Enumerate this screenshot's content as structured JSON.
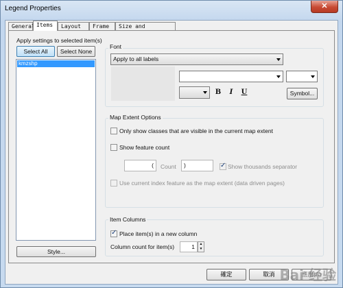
{
  "window": {
    "title": "Legend Properties",
    "close": "✕"
  },
  "tabs": [
    "General",
    "Items",
    "Layout",
    "Frame",
    "Size and Position"
  ],
  "left": {
    "apply_label": "Apply settings to selected item(s)",
    "select_all": "Select All",
    "select_none": "Select None",
    "items": [
      "kmzshp"
    ],
    "style_button": "Style..."
  },
  "font": {
    "group_label": "Font",
    "apply_combo": "Apply to all labels",
    "bold": "B",
    "italic": "I",
    "underline": "U",
    "symbol_button": "Symbol..."
  },
  "map_extent": {
    "group_label": "Map Extent Options",
    "only_show_classes": "Only show classes that are visible in the current map extent",
    "show_feature_count": "Show feature count",
    "count_label": "Count",
    "count_left": "(",
    "count_right": ")",
    "show_thousands": "Show thousands separator",
    "use_index_feature": "Use current index feature as the map extent (data driven pages)"
  },
  "item_columns": {
    "group_label": "Item Columns",
    "place_in_new_column": "Place item(s) in a new column",
    "column_count_label": "Column count for item(s)",
    "column_count_value": "1"
  },
  "footer": {
    "ok": "確定",
    "cancel": "取消",
    "apply": "應用(A)"
  },
  "watermark": "Bai 经验"
}
